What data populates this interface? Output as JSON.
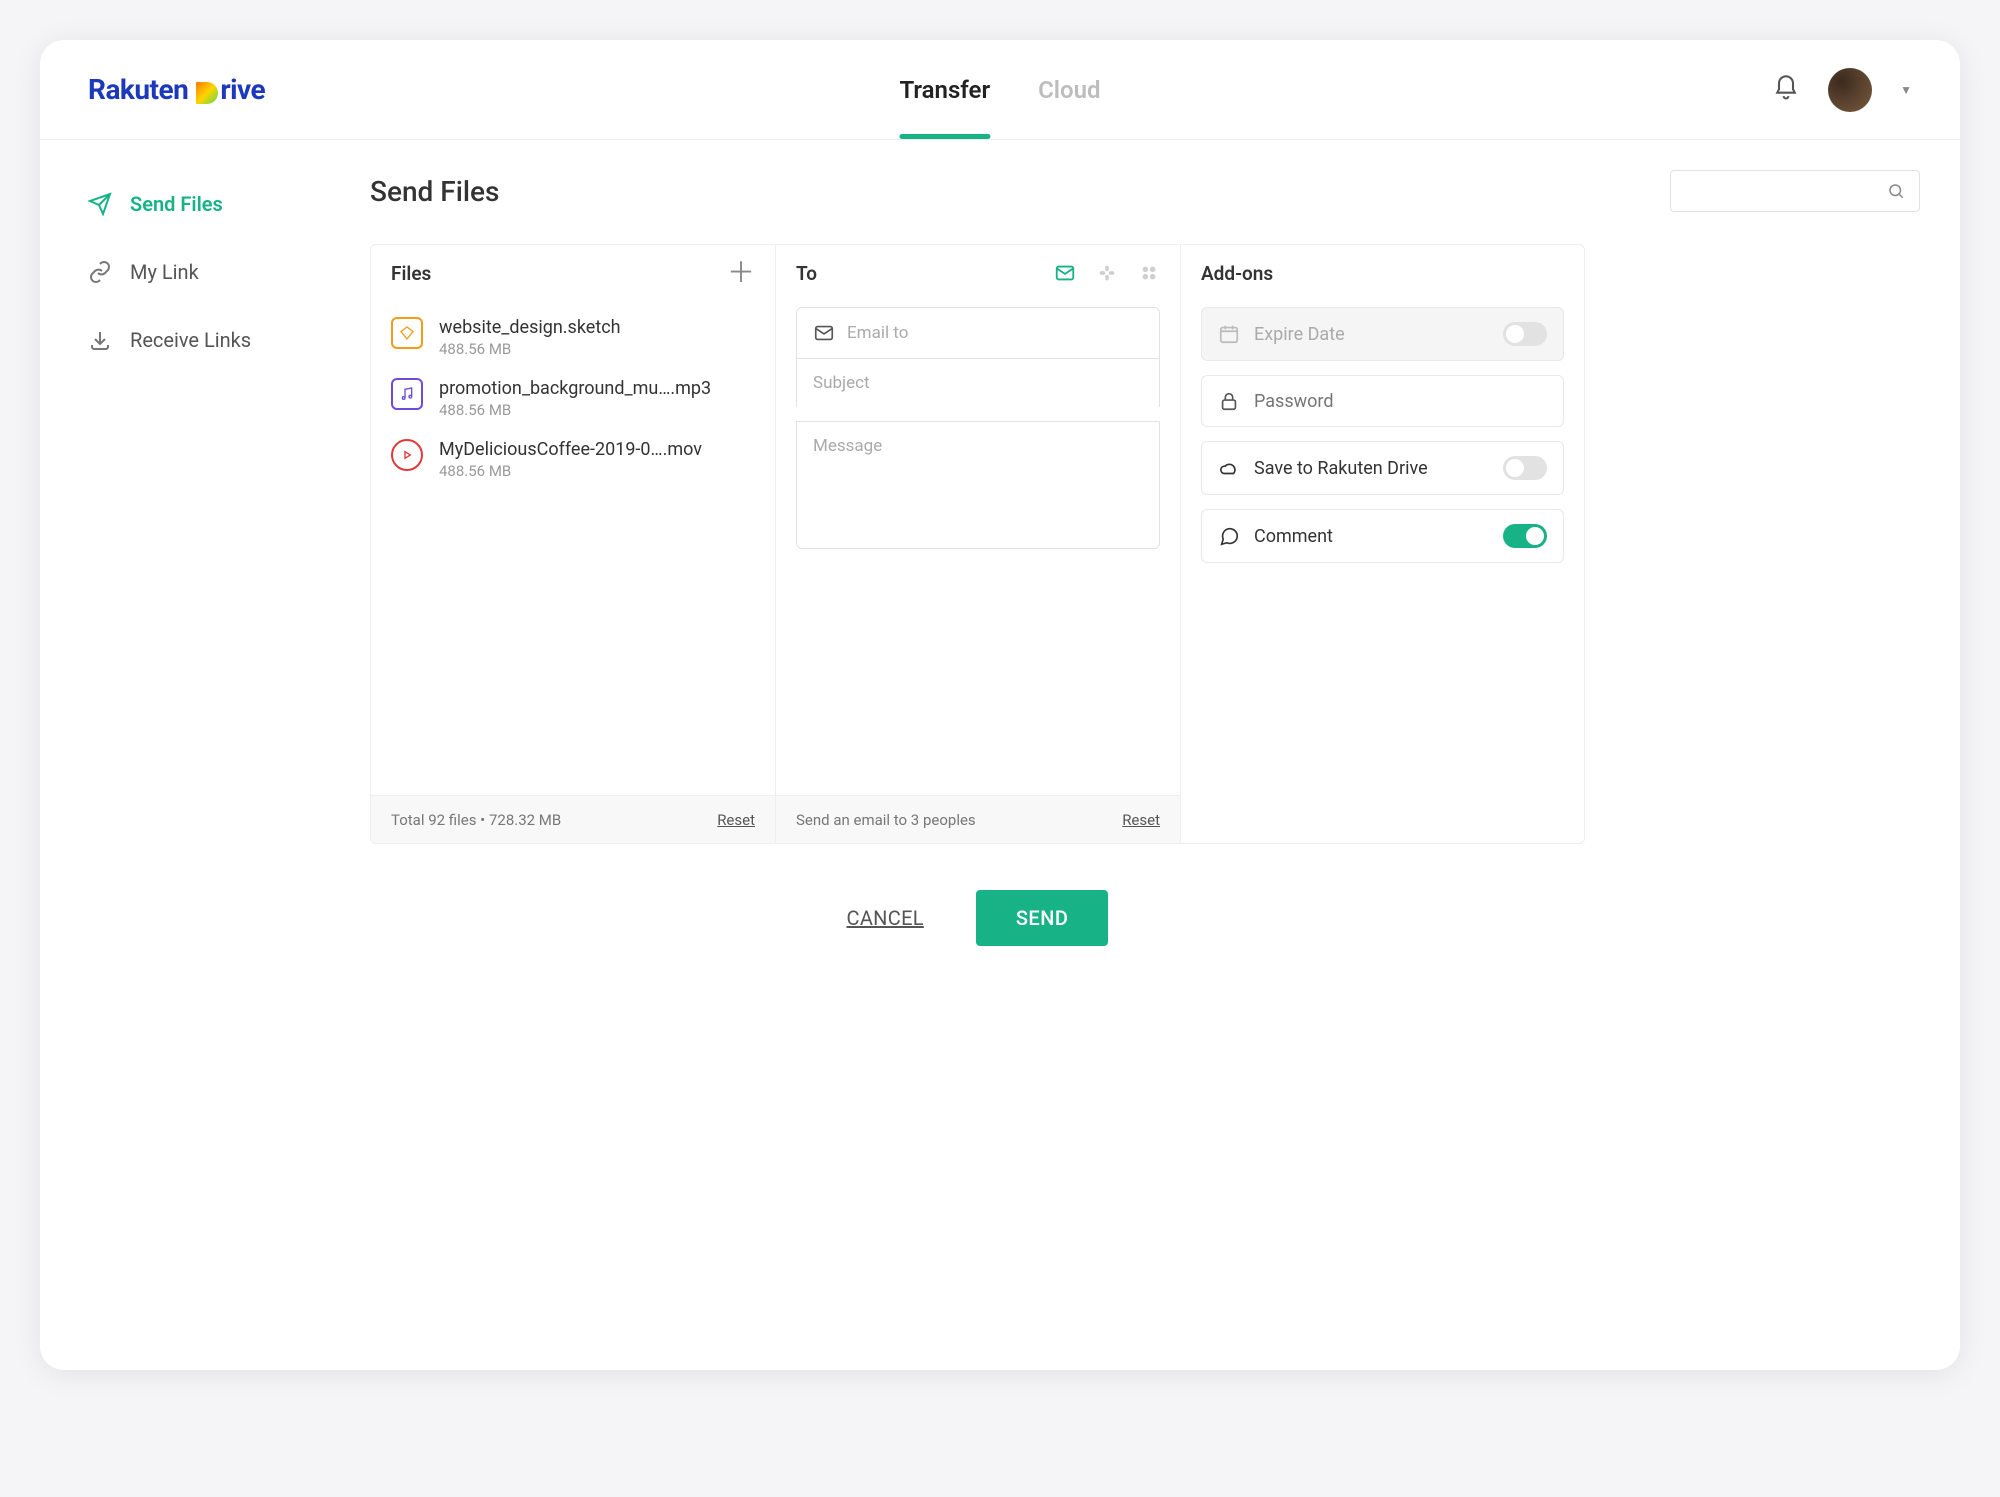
{
  "brand": {
    "name1": "Rakuten",
    "name2": "rive"
  },
  "tabs": {
    "transfer": "Transfer",
    "cloud": "Cloud"
  },
  "sidebar": {
    "send": "Send Files",
    "mylink": "My Link",
    "receive": "Receive Links"
  },
  "page_title": "Send Files",
  "files_panel": {
    "title": "Files",
    "footer": "Total 92 files • 728.32 MB",
    "reset": "Reset",
    "items": [
      {
        "name": "website_design.sketch",
        "size": "488.56 MB",
        "kind": "sketch"
      },
      {
        "name": "promotion_background_mu….mp3",
        "size": "488.56 MB",
        "kind": "audio"
      },
      {
        "name": "MyDeliciousCoffee-2019-0….mov",
        "size": "488.56 MB",
        "kind": "video"
      }
    ]
  },
  "to_panel": {
    "title": "To",
    "email_ph": "Email to",
    "subject_ph": "Subject",
    "message_ph": "Message",
    "footer": "Send an email  to 3 peoples",
    "reset": "Reset"
  },
  "addons_panel": {
    "title": "Add-ons",
    "expire": "Expire Date",
    "password": "Password",
    "save": "Save to Rakuten Drive",
    "comment": "Comment"
  },
  "actions": {
    "cancel": "CANCEL",
    "send": "SEND"
  }
}
